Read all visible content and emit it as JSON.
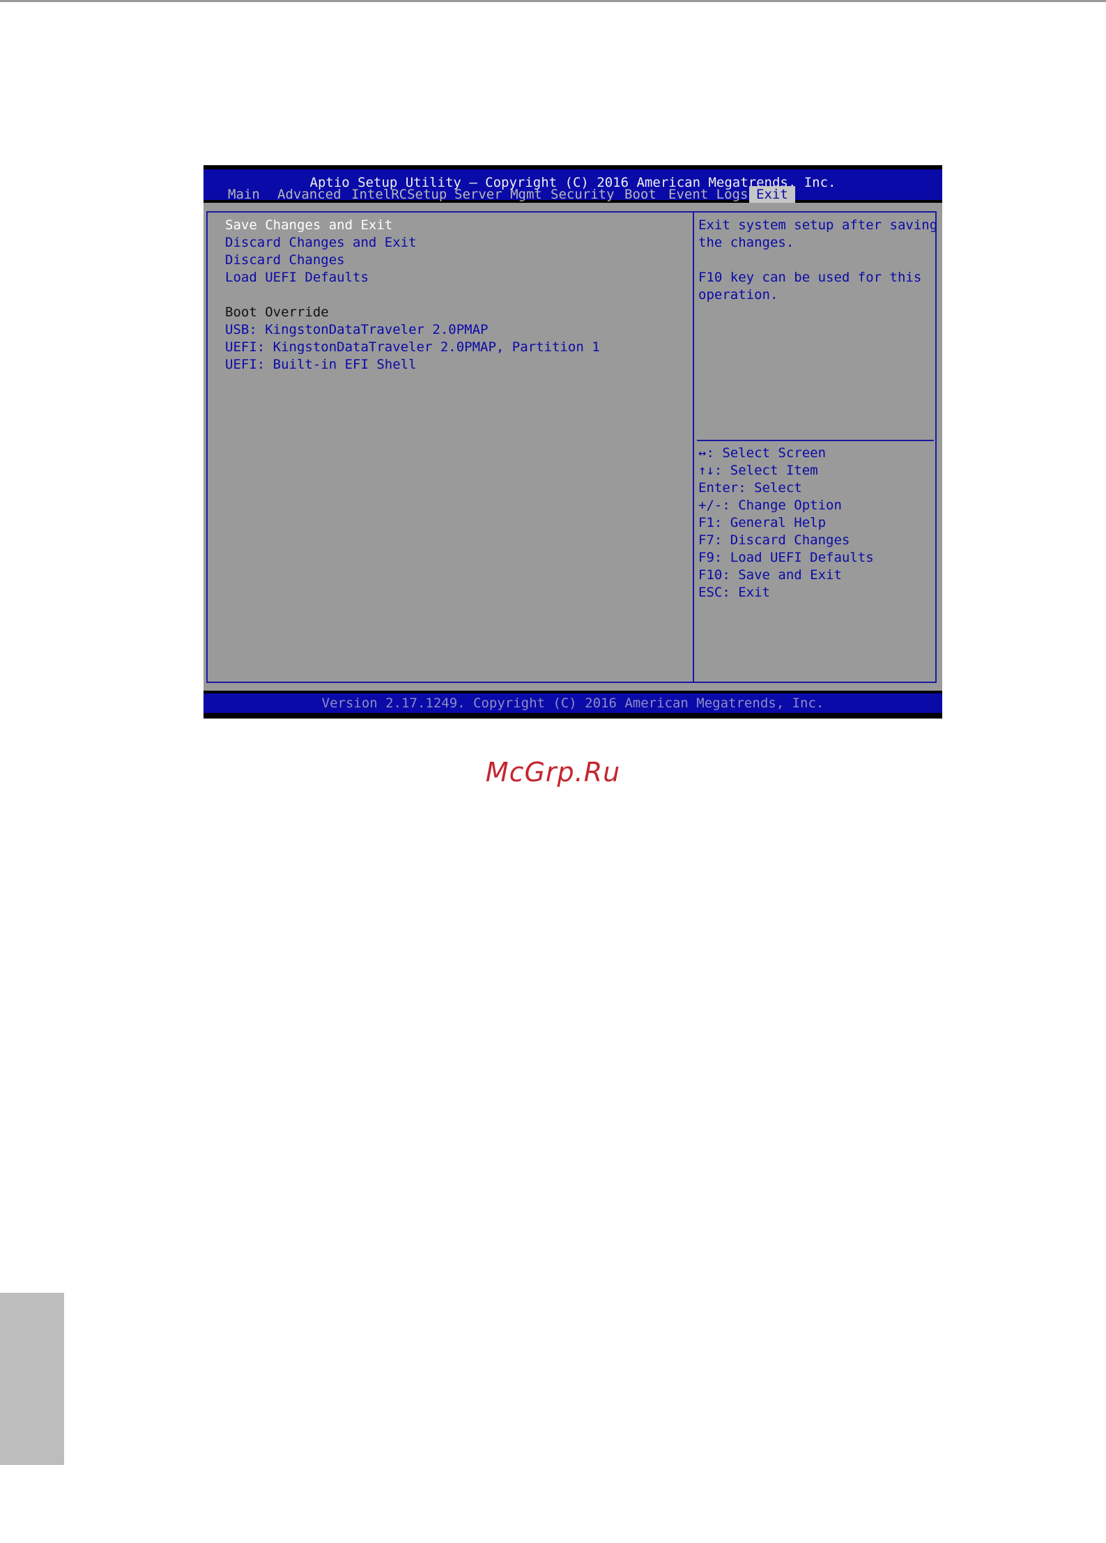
{
  "header": {
    "title": "Aptio Setup Utility – Copyright (C) 2016 American Megatrends, Inc."
  },
  "tabs": [
    {
      "label": "Main"
    },
    {
      "label": "Advanced"
    },
    {
      "label": "IntelRCSetup"
    },
    {
      "label": "Server Mgmt"
    },
    {
      "label": "Security"
    },
    {
      "label": "Boot"
    },
    {
      "label": "Event Logs"
    },
    {
      "label": "Exit",
      "active": true
    }
  ],
  "menu": {
    "items": [
      {
        "label": "Save Changes and Exit",
        "selected": true
      },
      {
        "label": "Discard Changes and Exit"
      },
      {
        "label": "Discard Changes"
      },
      {
        "label": "Load UEFI Defaults"
      }
    ],
    "boot_override": {
      "heading": "Boot Override",
      "items": [
        {
          "label": "USB: KingstonDataTraveler 2.0PMAP"
        },
        {
          "label": "UEFI: KingstonDataTraveler 2.0PMAP, Partition 1"
        },
        {
          "label": "UEFI: Built-in EFI Shell"
        }
      ]
    }
  },
  "help": {
    "description": [
      "Exit system setup after saving",
      "the changes.",
      "",
      "F10 key can be used for this",
      "operation."
    ],
    "keys": [
      "↔: Select Screen",
      "↑↓: Select Item",
      "Enter: Select",
      "+/-: Change Option",
      "F1: General Help",
      "F7: Discard Changes",
      "F9: Load UEFI Defaults",
      "F10: Save and Exit",
      "ESC: Exit"
    ]
  },
  "footer": {
    "version": "Version 2.17.1249. Copyright (C) 2016 American Megatrends, Inc."
  },
  "watermark": "McGrp.Ru",
  "colors": {
    "bios_blue": "#0a0aa8",
    "panel_gray": "#9a9a9a",
    "selected_text": "#ffffff",
    "watermark_red": "#c4262e"
  }
}
